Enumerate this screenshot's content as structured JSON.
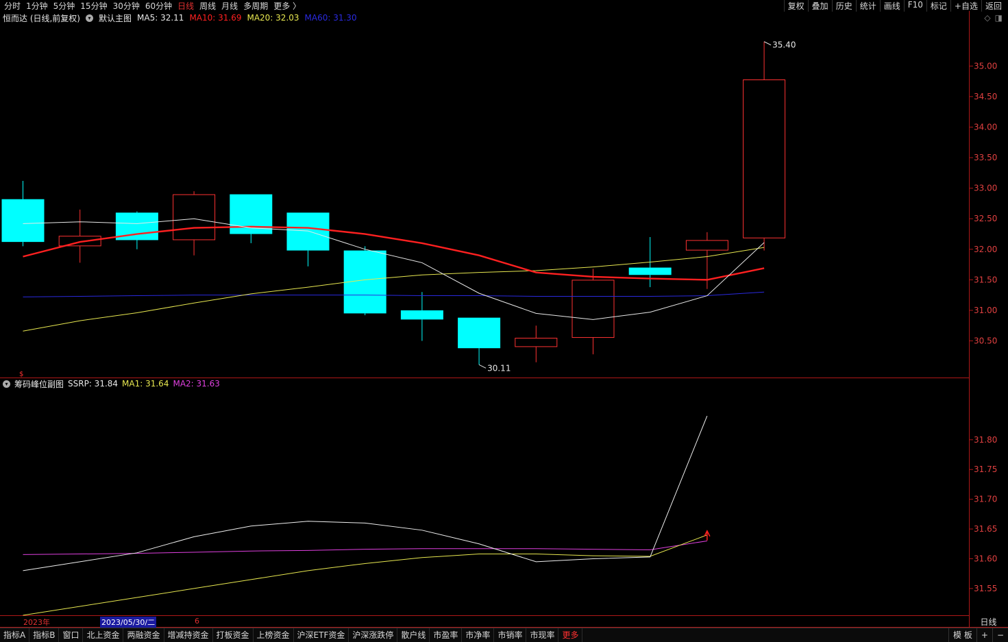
{
  "topbar": {
    "timeframes": [
      "分时",
      "1分钟",
      "5分钟",
      "15分钟",
      "30分钟",
      "60分钟",
      "日线",
      "周线",
      "月线",
      "多周期",
      "更多 〉"
    ],
    "active_index": 6,
    "right_buttons": [
      "复权",
      "叠加",
      "历史",
      "统计",
      "画线",
      "F10",
      "标记",
      "+自选",
      "返回"
    ]
  },
  "main_header": {
    "stock": "恒而达 (日线,前复权)",
    "chart_name": "默认主图",
    "ma5": "MA5: 32.11",
    "ma10": "MA10: 31.69",
    "ma20": "MA20: 32.03",
    "ma60": "MA60: 31.30"
  },
  "sub_header": {
    "chart_name": "筹码峰位副图",
    "ssrp": "SSRP: 31.84",
    "ma1": "MA1: 31.64",
    "ma2": "MA2: 31.63"
  },
  "colors": {
    "up": "#ff3232",
    "down": "#00ffff",
    "ma5": "#e8e8e8",
    "ma10": "#ff2020",
    "ma20": "#e8e850",
    "ma60": "#2a2ae0",
    "ssrp": "#f0f0f0",
    "ma1": "#e8e850",
    "ma2": "#e040e0",
    "axis": "#b01818",
    "axis_text": "#e04040"
  },
  "chart_data": [
    {
      "type": "candlestick",
      "title": "默认主图",
      "ylim": [
        29.9,
        35.7
      ],
      "y_ticks": [
        30.5,
        31.0,
        31.5,
        32.0,
        32.5,
        33.0,
        33.5,
        34.0,
        34.5,
        35.0
      ],
      "y_tick_labels": [
        "30.50",
        "31.00",
        "31.50",
        "32.00",
        "32.50",
        "33.00",
        "33.50",
        "34.00",
        "34.50",
        "35.00"
      ],
      "candles": [
        {
          "o": 32.82,
          "h": 33.12,
          "l": 32.05,
          "c": 32.12
        },
        {
          "o": 32.05,
          "h": 32.65,
          "l": 31.78,
          "c": 32.22
        },
        {
          "o": 32.6,
          "h": 32.62,
          "l": 32.0,
          "c": 32.15
        },
        {
          "o": 32.15,
          "h": 32.95,
          "l": 31.9,
          "c": 32.9
        },
        {
          "o": 32.9,
          "h": 32.9,
          "l": 32.1,
          "c": 32.25
        },
        {
          "o": 32.6,
          "h": 32.6,
          "l": 31.72,
          "c": 31.98
        },
        {
          "o": 31.98,
          "h": 32.05,
          "l": 30.92,
          "c": 30.95
        },
        {
          "o": 31.0,
          "h": 31.3,
          "l": 30.5,
          "c": 30.85
        },
        {
          "o": 30.88,
          "h": 30.88,
          "l": 30.11,
          "c": 30.38
        },
        {
          "o": 30.4,
          "h": 30.75,
          "l": 30.15,
          "c": 30.55
        },
        {
          "o": 30.55,
          "h": 31.68,
          "l": 30.28,
          "c": 31.5
        },
        {
          "o": 31.7,
          "h": 32.2,
          "l": 31.38,
          "c": 31.58
        },
        {
          "o": 31.98,
          "h": 32.28,
          "l": 31.35,
          "c": 32.15
        },
        {
          "o": 32.18,
          "h": 35.4,
          "l": 31.98,
          "c": 34.78
        }
      ],
      "series": [
        {
          "name": "MA5",
          "values": [
            32.42,
            32.45,
            32.42,
            32.5,
            32.35,
            32.3,
            32.0,
            31.78,
            31.28,
            30.95,
            30.85,
            30.97,
            31.24,
            32.11
          ]
        },
        {
          "name": "MA10",
          "values": [
            31.88,
            32.12,
            32.25,
            32.35,
            32.37,
            32.35,
            32.25,
            32.1,
            31.9,
            31.62,
            31.55,
            31.52,
            31.5,
            31.69
          ]
        },
        {
          "name": "MA20",
          "values": [
            30.66,
            30.83,
            30.96,
            31.12,
            31.27,
            31.38,
            31.5,
            31.58,
            31.62,
            31.65,
            31.71,
            31.79,
            31.88,
            32.03
          ]
        },
        {
          "name": "MA60",
          "values": [
            31.22,
            31.23,
            31.24,
            31.25,
            31.25,
            31.25,
            31.25,
            31.24,
            31.24,
            31.23,
            31.23,
            31.23,
            31.24,
            31.3
          ]
        }
      ],
      "annotations": [
        "35.40",
        "30.11"
      ]
    },
    {
      "type": "line",
      "title": "筹码峰位副图",
      "ylim": [
        31.505,
        31.885
      ],
      "y_ticks": [
        31.55,
        31.6,
        31.65,
        31.7,
        31.75,
        31.8
      ],
      "y_tick_labels": [
        "31.55",
        "31.60",
        "31.65",
        "31.70",
        "31.75",
        "31.80"
      ],
      "series": [
        {
          "name": "SSRP",
          "values": [
            31.58,
            31.595,
            31.61,
            31.637,
            31.655,
            31.663,
            31.66,
            31.648,
            31.625,
            31.595,
            31.6,
            31.603,
            31.84
          ]
        },
        {
          "name": "MA1",
          "values": [
            31.505,
            31.52,
            31.535,
            31.55,
            31.565,
            31.58,
            31.592,
            31.602,
            31.608,
            31.608,
            31.605,
            31.604,
            31.64
          ]
        },
        {
          "name": "MA2",
          "values": [
            31.607,
            31.608,
            31.609,
            31.611,
            31.613,
            31.614,
            31.616,
            31.617,
            31.617,
            31.617,
            31.616,
            31.615,
            31.63
          ]
        }
      ]
    }
  ],
  "timeline": {
    "year": "2023年",
    "date": "2023/05/30/二",
    "month": "6"
  },
  "bottombar": {
    "tabs": [
      "指标A",
      "指标B",
      "窗口",
      "北上资金",
      "两融资金",
      "增减持资金",
      "打板资金",
      "上榜资金",
      "沪深ETF资金",
      "沪深涨跌停",
      "散户线",
      "市盈率",
      "市净率",
      "市销率",
      "市现率",
      "更多"
    ],
    "right": [
      "模 板",
      "+",
      "−"
    ],
    "period": "日线"
  }
}
